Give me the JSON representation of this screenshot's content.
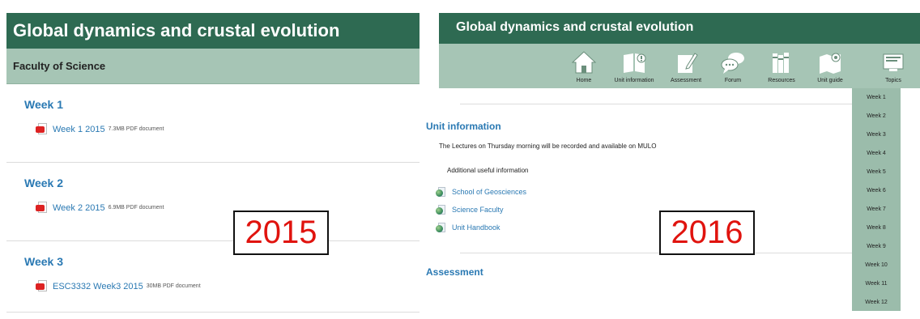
{
  "left": {
    "title": "Global dynamics and crustal evolution",
    "subtitle": "Faculty of Science",
    "weeks": [
      {
        "title": "Week 1",
        "file": {
          "label": "Week 1 2015",
          "meta": "7.3MB PDF document"
        }
      },
      {
        "title": "Week 2",
        "file": {
          "label": "Week 2 2015",
          "meta": "6.9MB PDF document"
        }
      },
      {
        "title": "Week 3",
        "file": {
          "label": "ESC3332 Week3 2015",
          "meta": "30MB PDF document"
        }
      }
    ]
  },
  "right": {
    "title": "Global dynamics and crustal evolution",
    "nav": [
      {
        "label": "Home",
        "icon": "home-icon"
      },
      {
        "label": "Unit information",
        "icon": "unit-information-icon"
      },
      {
        "label": "Assessment",
        "icon": "assessment-icon"
      },
      {
        "label": "Forum",
        "icon": "forum-icon"
      },
      {
        "label": "Resources",
        "icon": "resources-icon"
      },
      {
        "label": "Unit guide",
        "icon": "unit-guide-icon"
      },
      {
        "label": "Topics",
        "icon": "topics-icon"
      }
    ],
    "unit_info": {
      "title": "Unit information",
      "text": "The Lectures on Thursday morning will be recorded and available on MULO",
      "subheading": "Additional useful information",
      "links": [
        "School of Geosciences",
        "Science Faculty",
        "Unit Handbook"
      ]
    },
    "assessment_title": "Assessment",
    "topics": [
      "Week 1",
      "Week 2",
      "Week 3",
      "Week 4",
      "Week 5",
      "Week 6",
      "Week 7",
      "Week 8",
      "Week 9",
      "Week 10",
      "Week 11",
      "Week 12"
    ]
  },
  "labels": {
    "left_year": "2015",
    "right_year": "2016"
  },
  "colors": {
    "header": "#2e6a52",
    "subheader": "#a6c5b5",
    "link": "#2a79b3",
    "year_label": "#e0130e"
  }
}
